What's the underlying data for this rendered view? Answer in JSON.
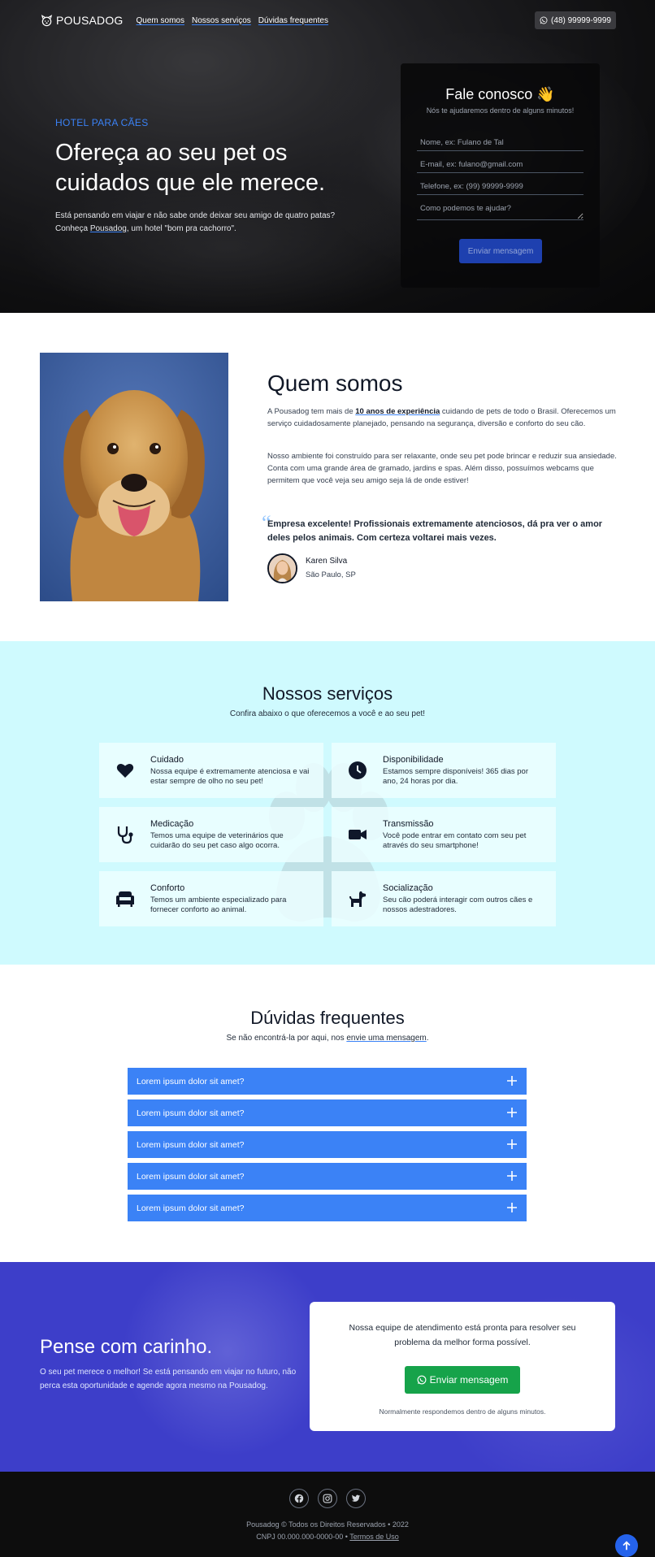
{
  "nav": {
    "logo": "POUSADOG",
    "links": [
      "Quem somos",
      "Nossos serviços",
      "Dúvidas frequentes"
    ],
    "phone": "(48) 99999-9999"
  },
  "hero": {
    "eyebrow": "HOTEL PARA CÃES",
    "title": "Ofereça ao seu pet os cuidados que ele merece.",
    "desc_1": "Está pensando em viajar e não sabe onde deixar seu amigo de quatro patas?",
    "desc_2a": "Conheça ",
    "desc_2_link": "Pousadog",
    "desc_2b": ", um hotel \"bom pra cachorro\"."
  },
  "contact": {
    "title": "Fale conosco 👋",
    "subtitle": "Nós te ajudaremos dentro de alguns minutos!",
    "name_placeholder": "Nome, ex: Fulano de Tal",
    "email_placeholder": "E-mail, ex: fulano@gmail.com",
    "phone_placeholder": "Telefone, ex: (99) 99999-9999",
    "message_placeholder": "Como podemos te ajudar?",
    "submit_label": "Enviar mensagem"
  },
  "about": {
    "title": "Quem somos",
    "p1a": "A Pousadog tem mais de ",
    "p1_strong": "10 anos de experiência",
    "p1b": " cuidando de pets de todo o Brasil. Oferecemos um serviço cuidadosamente planejado, pensando na segurança, diversão e conforto do seu cão.",
    "p2": "Nosso ambiente foi construído para ser relaxante, onde seu pet pode brincar e reduzir sua ansiedade. Conta com uma grande área de gramado, jardins e spas. Além disso, possuímos webcams que permitem que você veja seu amigo seja lá de onde estiver!",
    "quote_mark": "“",
    "quote": "Empresa excelente! Profissionais extremamente atenciosos, dá pra ver o amor deles pelos animais. Com certeza voltarei mais vezes.",
    "author_name": "Karen Silva",
    "author_location": "São Paulo, SP"
  },
  "services": {
    "title": "Nossos serviços",
    "subtitle": "Confira abaixo o que oferecemos a você e ao seu pet!",
    "items": [
      {
        "title": "Cuidado",
        "desc": "Nossa equipe é extremamente atenciosa e vai estar sempre de olho no seu pet!",
        "icon": "heart-icon"
      },
      {
        "title": "Disponibilidade",
        "desc": "Estamos sempre disponíveis! 365 dias por ano, 24 horas por dia.",
        "icon": "clock-icon"
      },
      {
        "title": "Medicação",
        "desc": "Temos uma equipe de veterinários que cuidarão do seu pet caso algo ocorra.",
        "icon": "stethoscope-icon"
      },
      {
        "title": "Transmissão",
        "desc": "Você pode entrar em contato com seu pet através do seu smartphone!",
        "icon": "video-camera-icon"
      },
      {
        "title": "Conforto",
        "desc": "Temos um ambiente especializado para fornecer conforto ao animal.",
        "icon": "couch-icon"
      },
      {
        "title": "Socialização",
        "desc": "Seu cão poderá interagir com outros cães e nossos adestradores.",
        "icon": "dog-icon"
      }
    ]
  },
  "faq": {
    "title": "Dúvidas frequentes",
    "sub_a": "Se não encontrá-la por aqui, nos ",
    "sub_link": "envie uma mensagem",
    "sub_b": ".",
    "items": [
      "Lorem ipsum dolor sit amet?",
      "Lorem ipsum dolor sit amet?",
      "Lorem ipsum dolor sit amet?",
      "Lorem ipsum dolor sit amet?",
      "Lorem ipsum dolor sit amet?"
    ]
  },
  "cta": {
    "title": "Pense com carinho.",
    "desc": "O seu pet merece o melhor! Se está pensando em viajar no futuro, não perca esta oportunidade e agende agora mesmo na Pousadog.",
    "card_text": "Nossa equipe de atendimento está pronta para resolver seu problema da melhor forma possível.",
    "button_label": "Enviar mensagem",
    "note": "Normalmente respondemos dentro de alguns minutos."
  },
  "footer": {
    "line1": "Pousadog © Todos os Direitos Reservados • 2022",
    "line2a": "CNPJ 00.000.000-0000-00 • ",
    "line2_link": "Termos de Uso"
  },
  "colors": {
    "accent": "#3b82f6",
    "services_bg": "#cffafe",
    "cta_bg": "#3d3ec9",
    "whatsapp": "#16a34a"
  }
}
